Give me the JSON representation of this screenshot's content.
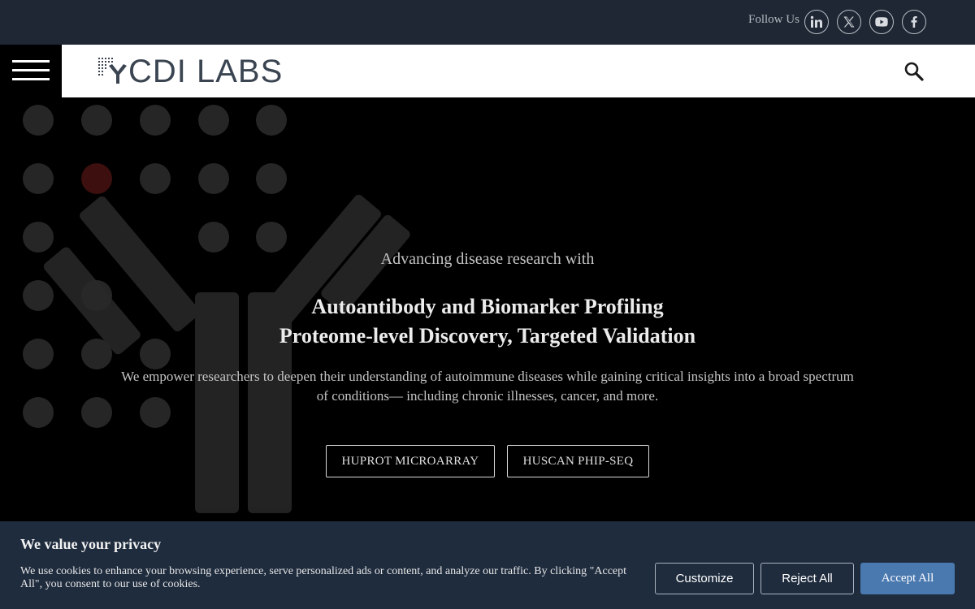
{
  "social": {
    "label": "Follow Us",
    "icons": [
      "linkedin-icon",
      "x-twitter-icon",
      "youtube-icon",
      "facebook-icon"
    ]
  },
  "header": {
    "logo_text": "CDI LABS",
    "menu_icon": "hamburger-menu-icon",
    "search_icon": "search-icon"
  },
  "hero": {
    "intro": "Advancing disease research with",
    "title_line1": "Autoantibody and Biomarker Profiling",
    "title_line2": "Proteome-level Discovery, Targeted Validation",
    "description": "We empower researchers to deepen their understanding of autoimmune diseases while gaining critical insights into a broad spectrum of conditions— including chronic illnesses, cancer, and more.",
    "buttons": [
      "HUPROT MICROARRAY",
      "HUSCAN PHIP-SEQ"
    ]
  },
  "cookie": {
    "title": "We value your privacy",
    "text": "We use cookies to enhance your browsing experience, serve personalized ads or content, and analyze our traffic. By clicking \"Accept All\", you consent to our use of cookies.",
    "customize": "Customize",
    "reject": "Reject All",
    "accept": "Accept All"
  },
  "colors": {
    "topbar": "#1e2733",
    "cookie_bg": "#1f2c3e",
    "accept_button": "#4a79b0",
    "logo_text": "#3b4552"
  }
}
